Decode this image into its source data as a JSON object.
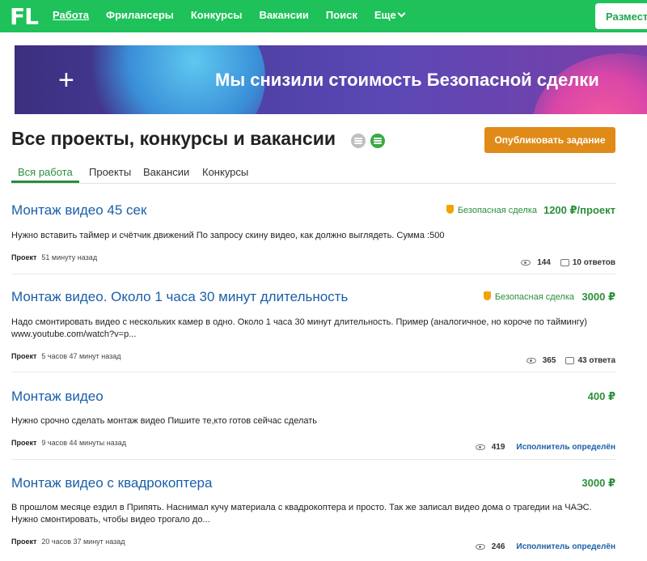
{
  "header": {
    "logo": "FL",
    "nav": [
      "Работа",
      "Фрилансеры",
      "Конкурсы",
      "Вакансии",
      "Поиск",
      "Еще"
    ],
    "place_button": "Разместить"
  },
  "banner": {
    "text": "Мы снизили стоимость Безопасной сделки",
    "plus": "+"
  },
  "page": {
    "title": "Все проекты, конкурсы и вакансии",
    "publish_button": "Опубликовать задание",
    "tabs": [
      "Вся работа",
      "Проекты",
      "Вакансии",
      "Конкурсы"
    ]
  },
  "projects": [
    {
      "title": "Монтаж видео 45 сек",
      "safe_deal": "Безопасная сделка",
      "price": "1200 ₽/проект",
      "description": "Нужно вставить таймер и счётчик движений По запросу скину видео, как должно выглядеть. Сумма :500",
      "type": "Проект",
      "time": "51 минуту назад",
      "views": "144",
      "responses": "10 ответов"
    },
    {
      "title": "Монтаж видео. Около 1 часа 30 минут длительность",
      "safe_deal": "Безопасная сделка",
      "price": "3000 ₽",
      "description": "Надо смонтировать видео с нескольких камер в одно. Около 1 часа 30 минут длительность. Пример (аналогичное, но короче по таймингу) www.youtube.com/watch?v=p...",
      "type": "Проект",
      "time": "5 часов 47 минут назад",
      "views": "365",
      "responses": "43 ответа"
    },
    {
      "title": "Монтаж видео",
      "price": "400 ₽",
      "description": "Нужно срочно сделать монтаж видео Пишите те,кто готов сейчас сделать",
      "type": "Проект",
      "time": "9 часов 44 минуты назад",
      "views": "419",
      "executor": "Исполнитель определён"
    },
    {
      "title": "Монтаж видео с квадрокоптера",
      "price": "3000 ₽",
      "description": "В прошлом месяце ездил в Припять. Наснимал кучу материала с квадрокоптера и просто. Так же записал видео дома о трагедии на ЧАЭС. Нужно смонтировать, чтобы видео трогало до...",
      "type": "Проект",
      "time": "20 часов 37 минут назад",
      "views": "246",
      "executor": "Исполнитель определён"
    }
  ],
  "colors": {
    "header_green": "#1ec15a",
    "link_blue": "#1a5fa8",
    "price_green": "#2b8f3b",
    "publish_orange": "#e08a18"
  }
}
